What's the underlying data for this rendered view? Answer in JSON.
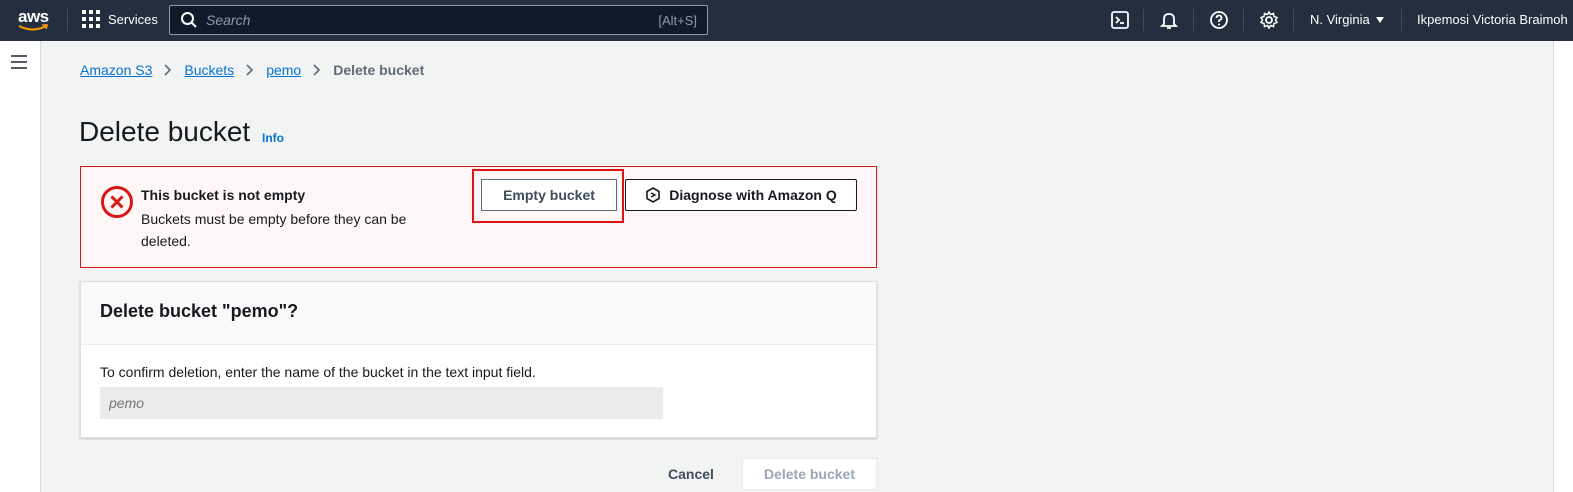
{
  "topnav": {
    "logo_text": "aws",
    "services_label": "Services",
    "search_placeholder": "Search",
    "search_shortcut": "[Alt+S]",
    "region": "N. Virginia",
    "user": "Ikpemosi Victoria Braimoh",
    "icons": [
      "cloudshell-icon",
      "bell-icon",
      "help-icon",
      "settings-icon"
    ]
  },
  "breadcrumb": {
    "items": [
      "Amazon S3",
      "Buckets",
      "pemo"
    ],
    "current": "Delete bucket"
  },
  "page": {
    "title": "Delete bucket",
    "info": "Info"
  },
  "alert": {
    "title": "This bucket is not empty",
    "body": "Buckets must be empty before they can be deleted.",
    "empty_button": "Empty bucket",
    "diagnose_button": "Diagnose with Amazon Q"
  },
  "confirm": {
    "title": "Delete bucket \"pemo\"?",
    "description": "To confirm deletion, enter the name of the bucket in the text input field.",
    "input_placeholder": "pemo"
  },
  "actions": {
    "cancel": "Cancel",
    "delete": "Delete bucket"
  },
  "colors": {
    "nav_bg": "#232f3e",
    "link": "#0972d3",
    "error": "#d91515",
    "alert_bg": "#fff7f7"
  }
}
